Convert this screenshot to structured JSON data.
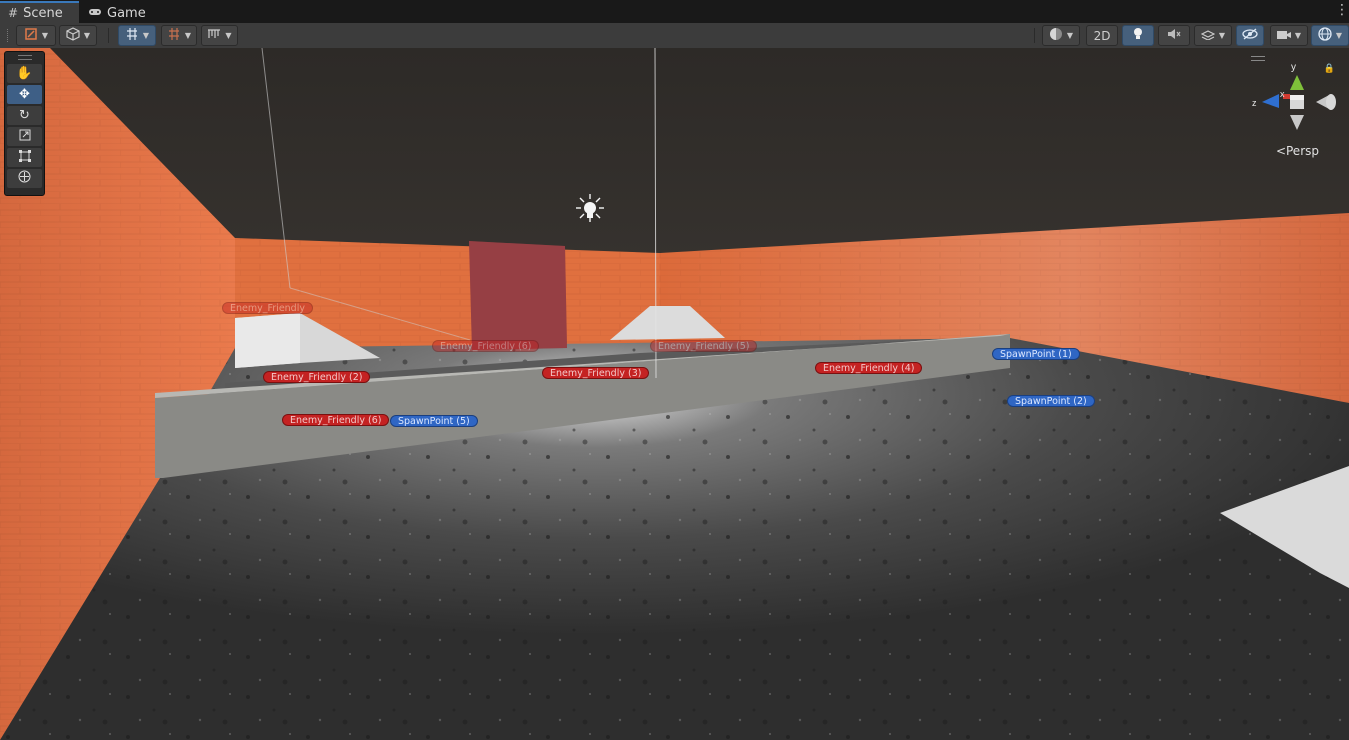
{
  "tabs": [
    {
      "label": "Scene",
      "icon": "grid-icon",
      "active": true
    },
    {
      "label": "Game",
      "icon": "gamepad-icon",
      "active": false
    }
  ],
  "toolbar": {
    "two_d_label": "2D",
    "left_buttons": [
      "draw-mode",
      "shaded-cube",
      "pivot-toggle",
      "grid-snap",
      "ruler-snap"
    ],
    "right_buttons": [
      "render-sphere",
      "2d",
      "lighting",
      "audio-mute",
      "effects",
      "hidden-objects",
      "camera",
      "gizmos"
    ]
  },
  "tools": [
    "hand-icon",
    "move-icon",
    "rotate-icon",
    "scale-icon",
    "rect-icon",
    "transform-icon"
  ],
  "gizmo": {
    "persp_label": "Persp",
    "axis_x": "x",
    "axis_y": "y",
    "axis_z": "z"
  },
  "labels": {
    "enemy_friendly": "Enemy_Friendly",
    "enemy_friendly_2": "Enemy_Friendly (2)",
    "enemy_friendly_3": "Enemy_Friendly (3)",
    "enemy_friendly_4": "Enemy_Friendly (4)",
    "enemy_friendly_5": "Enemy_Friendly (5)",
    "enemy_friendly_6": "Enemy_Friendly (6)",
    "spawn_1": "SpawnPoint (1)",
    "spawn_2": "SpawnPoint (2)",
    "spawn_5": "SpawnPoint (5)"
  },
  "colors": {
    "accent": "#3a79bb",
    "enemy_label": "#c42222",
    "spawn_label": "#2f66c4",
    "wall": "#e0683e"
  }
}
